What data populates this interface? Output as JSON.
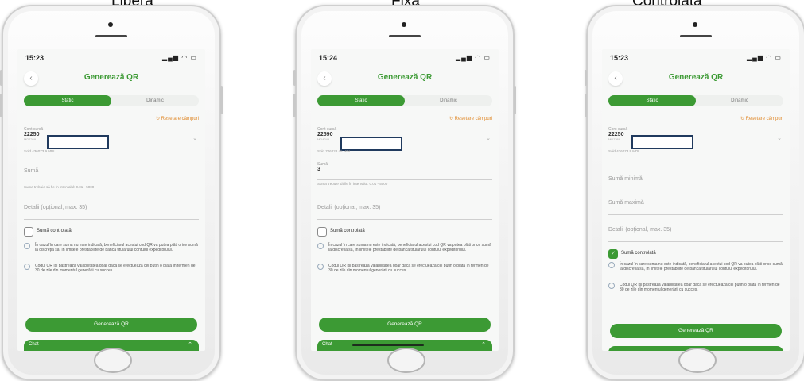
{
  "captions": [
    "Liberă",
    "Fixă",
    "Controlată"
  ],
  "phones": [
    {
      "time": "15:23",
      "title": "Generează QR",
      "tab_active": "Static",
      "tab_inactive": "Dinamic",
      "reset": "Resetare câmpuri",
      "account_label": "Cont sursă",
      "account_value": "22250",
      "account_sub": "MD7369",
      "balance": "Sold 436073.9 MDL",
      "amount_label": "Sumă",
      "amount_hint": "Suma trebuie să fie în intervalul: 0.01 - 5000",
      "details_placeholder": "Detalii (opțional, max. 35)",
      "checkbox_label": "Sumă controlată",
      "info1": "În cazul în care suma nu este indicată, beneficiarul acestui cod QR va putea plăti orice sumă la discreția sa, în limitele prestabilite de banca titularului contului expeditorului.",
      "info2": "Codul QR își păstrează valabilitatea doar dacă se efectuează cel puțin o plată în termen de 30 de zile din momentul generării cu succes.",
      "generate": "Generează QR",
      "chat": "Chat"
    },
    {
      "time": "15:24",
      "title": "Generează QR",
      "tab_active": "Static",
      "tab_inactive": "Dinamic",
      "reset": "Resetare câmpuri",
      "account_label": "Cont sursă",
      "account_value": "22590",
      "account_sub": "MD4249",
      "balance": "Sold 706228.45 MDL",
      "amount_label": "Sumă",
      "amount_value": "3",
      "amount_hint": "Suma trebuie să fie în intervalul: 0.01 - 5000",
      "details_placeholder": "Detalii (opțional, max. 35)",
      "checkbox_label": "Sumă controlată",
      "info1": "În cazul în care suma nu este indicată, beneficiarul acestui cod QR va putea plăti orice sumă la discreția sa, în limitele prestabilite de banca titularului contului expeditorului.",
      "info2": "Codul QR își păstrează valabilitatea doar dacă se efectuează cel puțin o plată în termen de 30 de zile din momentul generării cu succes.",
      "generate": "Generează QR",
      "chat": "Chat"
    },
    {
      "time": "15:23",
      "title": "Generează QR",
      "tab_active": "Static",
      "tab_inactive": "Dinamic",
      "reset": "Resetare câmpuri",
      "account_label": "Cont sursă",
      "account_value": "22250",
      "account_sub": "MD7369",
      "balance": "Sold 436073.9 MDL",
      "min_placeholder": "Sumă minimă",
      "max_placeholder": "Sumă maximă",
      "details_placeholder": "Detalii (opțional, max. 35)",
      "checkbox_label": "Sumă controlată",
      "info1": "În cazul în care suma nu este indicată, beneficiarul acestui cod QR va putea plăti orice sumă la discreția sa, în limitele prestabilite de banca titularului contului expeditorului.",
      "info2": "Codul QR își păstrează valabilitatea doar dacă se efectuează cel puțin o plată în termen de 30 de zile din momentul generării cu succes.",
      "generate": "Generează QR"
    }
  ]
}
